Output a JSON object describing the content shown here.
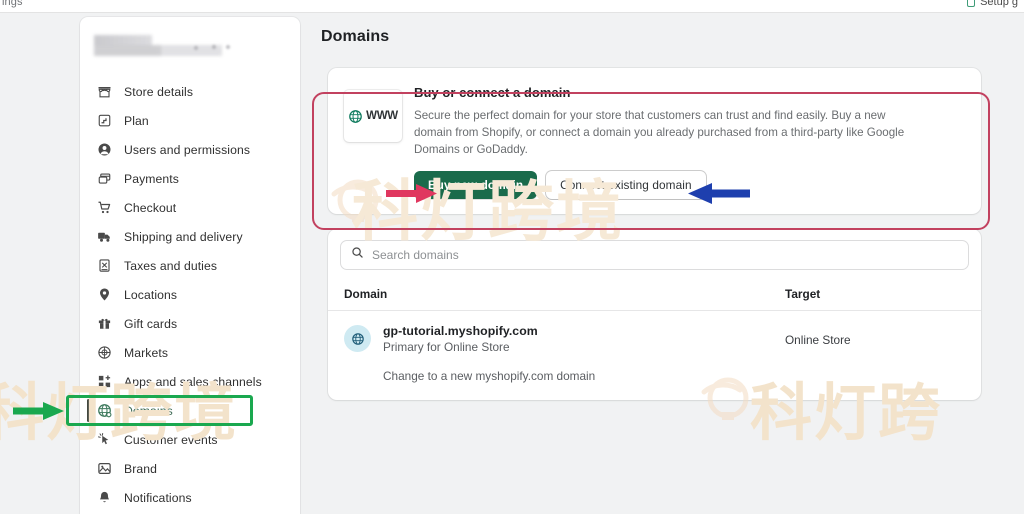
{
  "chrome": {
    "left_label": "ings",
    "right_label": "Setup g",
    "setup_icon": "setup-guide-icon"
  },
  "sidebar": {
    "store_name_redacted": "",
    "items": [
      {
        "label": "Store details",
        "icon": "storefront-icon",
        "active": false
      },
      {
        "label": "Plan",
        "icon": "plan-icon",
        "active": false
      },
      {
        "label": "Users and permissions",
        "icon": "user-icon",
        "active": false
      },
      {
        "label": "Payments",
        "icon": "payments-icon",
        "active": false
      },
      {
        "label": "Checkout",
        "icon": "cart-icon",
        "active": false
      },
      {
        "label": "Shipping and delivery",
        "icon": "truck-icon",
        "active": false
      },
      {
        "label": "Taxes and duties",
        "icon": "taxes-icon",
        "active": false
      },
      {
        "label": "Locations",
        "icon": "pin-icon",
        "active": false
      },
      {
        "label": "Gift cards",
        "icon": "gift-icon",
        "active": false
      },
      {
        "label": "Markets",
        "icon": "globe-markets-icon",
        "active": false
      },
      {
        "label": "Apps and sales channels",
        "icon": "apps-icon",
        "active": false
      },
      {
        "label": "Domains",
        "icon": "globe-icon",
        "active": true
      },
      {
        "label": "Customer events",
        "icon": "cursor-click-icon",
        "active": false
      },
      {
        "label": "Brand",
        "icon": "brand-image-icon",
        "active": false
      },
      {
        "label": "Notifications",
        "icon": "bell-icon",
        "active": false
      }
    ]
  },
  "main": {
    "page_title": "Domains",
    "banner": {
      "icon_label": "WWW",
      "icon_name": "www-globe-icon",
      "title": "Buy or connect a domain",
      "description": "Secure the perfect domain for your store that customers can trust and find easily. Buy a new domain from Shopify, or connect a domain you already purchased from a third-party like Google Domains or GoDaddy.",
      "primary_button": "Buy new domain",
      "secondary_button": "Connect existing domain"
    },
    "search": {
      "placeholder": "Search domains",
      "value": "",
      "icon": "search-icon"
    },
    "table": {
      "columns": [
        "Domain",
        "Target"
      ],
      "rows": [
        {
          "domain": "gp-tutorial.myshopify.com",
          "subtitle": "Primary for Online Store",
          "link": "Change to a new myshopify.com domain",
          "target": "Online Store",
          "icon": "globe-icon"
        }
      ]
    }
  },
  "annotations": {
    "green_box_color": "#1aa84f",
    "green_arrow_color": "#1aa84f",
    "crimson_box_color": "#c2415f",
    "pink_arrow_color": "#e0375f",
    "blue_arrow_color": "#1e3fae",
    "green_arrow_target": "Domains",
    "pink_arrow_target": "Buy new domain",
    "blue_arrow_target": "Connect existing domain"
  },
  "watermark": {
    "text_left": "科灯跨境",
    "text_center": "科灯跨境",
    "text_right": "科灯跨",
    "color": "#f3e3cb"
  }
}
